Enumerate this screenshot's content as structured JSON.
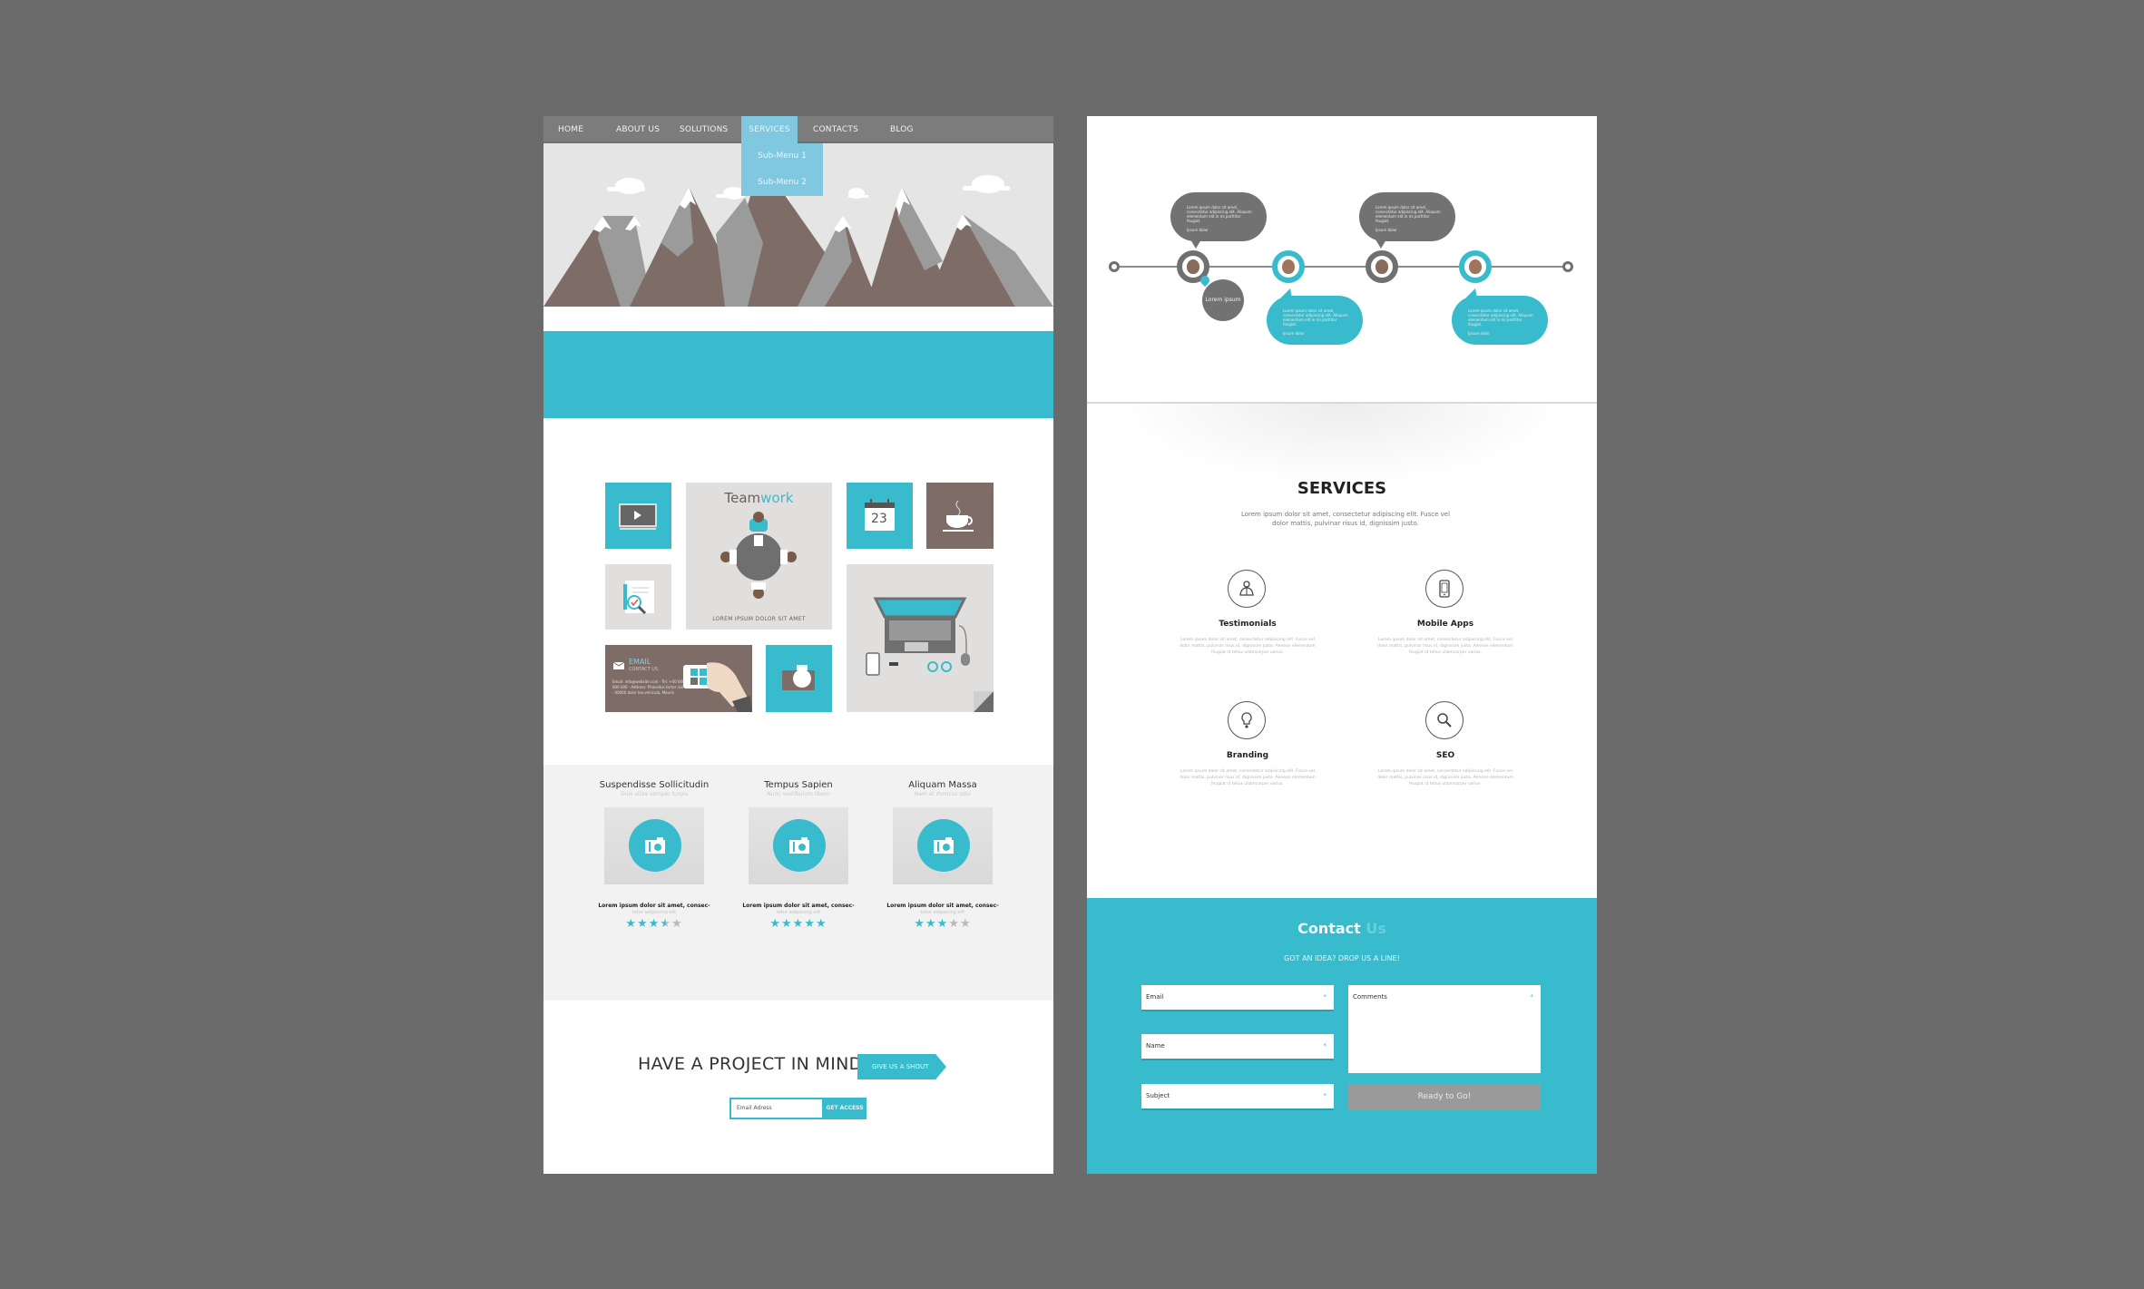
{
  "colors": {
    "background": "#6b6b6b",
    "accent": "#38bccd",
    "nav": "#7c7c7c",
    "submenu": "#7fc8df",
    "brown": "#7d6d66",
    "tile_gray": "#e0dfdd"
  },
  "page1": {
    "nav": {
      "items": [
        {
          "label": "HOME"
        },
        {
          "label": "ABOUT US"
        },
        {
          "label": "SOLUTIONS"
        },
        {
          "label": "SERVICES",
          "active": true
        },
        {
          "label": "CONTACTS"
        },
        {
          "label": "BLOG"
        }
      ],
      "submenu": [
        "Sub-Menu 1",
        "Sub-Menu 2"
      ]
    },
    "tiles": {
      "teamwork_title_a": "Team",
      "teamwork_title_b": "work",
      "teamwork_caption": "LOREM IPSUM DOLOR SIT AMET",
      "calendar_day": "23",
      "email_title": "EMAIL",
      "email_sub": "CONTACT US",
      "email_lines": "Email: info@website.com · Tel: +00 000 000 000 · Address: Phasellus tortor nisi · 00000 dolor leo vehicula, Mauris"
    },
    "products": [
      {
        "title": "Suspendisse Sollicitudin",
        "subtitle": "Duis vitae semper turpis",
        "desc": "Lorem ipsum dolor sit amet, consec-",
        "desc2": "tetur adipiscing elit",
        "rating": 3.5,
        "max": 5
      },
      {
        "title": "Tempus Sapien",
        "subtitle": "Nunc vestibulum libero",
        "desc": "Lorem ipsum dolor sit amet, consec-",
        "desc2": "tetur adipiscing elit",
        "rating": 5,
        "max": 5
      },
      {
        "title": "Aliquam Massa",
        "subtitle": "Nam at rhoncus odio",
        "desc": "Lorem ipsum dolor sit amet, consec-",
        "desc2": "tetur adipiscing elit",
        "rating": 3,
        "max": 5
      }
    ],
    "cta": {
      "title": "HAVE A PROJECT IN MIND?",
      "button": "GIVE US A SHOUT",
      "email_placeholder": "Email Adress",
      "access_button": "GET ACCESS"
    }
  },
  "page2": {
    "timeline": {
      "bubbles": [
        {
          "text": "Lorem ipsum dolor sit amet, consectetur adipiscing elit. Aliquam elementum elit in mi porttitor feugiat.",
          "sig": "Ipsum dolor"
        },
        {
          "text": "Lorem ipsum dolor sit amet, consectetur adipiscing elit. Aliquam elementum elit in mi porttitor feugiat.",
          "sig": "Ipsum dolor"
        },
        {
          "text": "Lorem ipsum dolor sit amet, consectetur adipiscing elit. Aliquam elementum elit in mi porttitor feugiat.",
          "sig": "Ipsum dolor"
        },
        {
          "text": "Lorem ipsum dolor sit amet, consectetur adipiscing elit. Aliquam elementum elit in mi porttitor feugiat.",
          "sig": "Ipsum dolor"
        }
      ],
      "small_bubble": "Lorem ipsum"
    },
    "services": {
      "title": "SERVICES",
      "description": "Lorem ipsum dolor sit amet, consectetur adipiscing elit. Fusce vel dolor mattis, pulvinar risus id, dignissim justo.",
      "items": [
        {
          "name": "Testimonials",
          "icon": "people-icon",
          "text": "Lorem ipsum dolor sit amet, consectetur adipiscing elit. Fusce vel dolor mattis, pulvinar risus id, dignissim justo. Aenean elementum feugiat id tellus ullamcorper varius."
        },
        {
          "name": "Mobile Apps",
          "icon": "mobile-icon",
          "text": "Lorem ipsum dolor sit amet, consectetur adipiscing elit. Fusce vel dolor mattis, pulvinar risus id, dignissim justo. Aenean elementum feugiat id tellus ullamcorper varius."
        },
        {
          "name": "Branding",
          "icon": "lightbulb-icon",
          "text": "Lorem ipsum dolor sit amet, consectetur adipiscing elit. Fusce vel dolor mattis, pulvinar risus id, dignissim justo. Aenean elementum feugiat id tellus ullamcorper varius."
        },
        {
          "name": "SEO",
          "icon": "search-icon",
          "text": "Lorem ipsum dolor sit amet, consectetur adipiscing elit. Fusce vel dolor mattis, pulvinar risus id, dignissim justo. Aenean elementum feugiat id tellus ullamcorper varius."
        }
      ]
    },
    "contact": {
      "title_a": "Contact",
      "title_b": "Us",
      "subtitle": "GOT AN IDEA? DROP US A LINE!",
      "fields": {
        "email": "Email",
        "name": "Name",
        "subject": "Subject",
        "comments": "Comments",
        "required_mark": "*"
      },
      "submit": "Ready to Go!"
    }
  }
}
